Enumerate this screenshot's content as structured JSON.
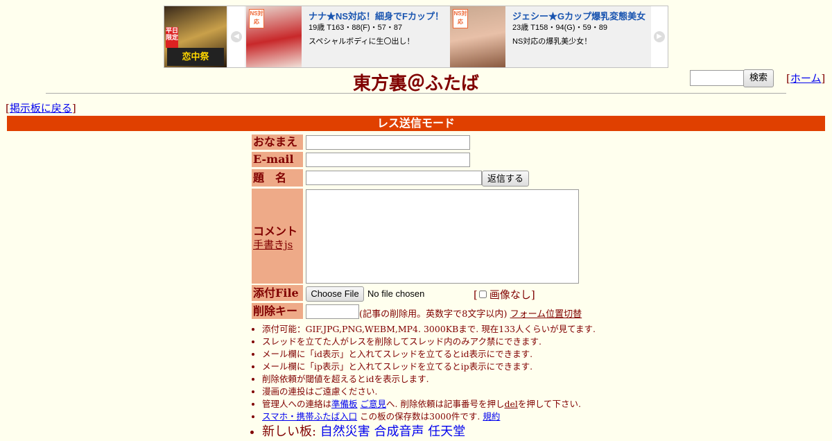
{
  "ad": {
    "left_banner": {
      "badge": "平日限定",
      "text": "恋中祭"
    },
    "cards": [
      {
        "title": "ナナ★NS対応！細身でFカップ！",
        "spec": "19歳 T163・88(F)・57・87",
        "desc": "スペシャルボディに生〇出し！",
        "badge": "NS対応"
      },
      {
        "title": "ジェシー★Gカップ爆乳変態美女",
        "spec": "23歳 T158・94(G)・59・89",
        "desc": "NS対応の爆乳美少女！",
        "badge": "NS対応"
      }
    ]
  },
  "header": {
    "title": "東方裏＠ふたば",
    "search_button": "検索",
    "home_link": "ホーム"
  },
  "nav": {
    "back_link": "掲示板に戻る"
  },
  "mode": {
    "label": "レス送信モード"
  },
  "form": {
    "name_label": "おなまえ",
    "email_label": "E-mail",
    "subject_label": "題　名",
    "submit_button": "返信する",
    "comment_label": "コメント",
    "handwrite_link": "手書きjs",
    "file_label": "添付File",
    "choose_file_button": "Choose File",
    "no_file_text": "No file chosen",
    "no_image_label": "画像なし",
    "delkey_label": "削除キー",
    "delkey_note": "(記事の削除用。英数字で8文字以内)",
    "form_toggle_link": "フォーム位置切替"
  },
  "notes": {
    "line1": "添付可能：GIF,JPG,PNG,WEBM,MP4. 3000KBまで. 現在133人くらいが見てます.",
    "line2": "スレッドを立てた人がレスを削除してスレッド内のみアク禁にできます.",
    "line3": "メール欄に「id表示」と入れてスレッドを立てるとid表示にできます.",
    "line4": "メール欄に「ip表示」と入れてスレッドを立てるとip表示にできます.",
    "line5": "削除依頼が閾値を超えるとidを表示します.",
    "line6": "漫画の連投はご遠慮ください.",
    "line7_pre": "管理人への連絡は",
    "line7_link1": "準備板",
    "line7_link2": "ご意見",
    "line7_mid": "へ. 削除依頼は記事番号を押し",
    "line7_link3": "del",
    "line7_post": "を押して下さい.",
    "line8_link1": "スマホ・携帯ふたば入口",
    "line8_mid": " この板の保存数は3000件です.",
    "line8_link2": "規約",
    "line9_pre": "新しい板: ",
    "line9_link1": "自然災害",
    "line9_link2": "合成音声",
    "line9_link3": "任天堂"
  },
  "colors": {
    "background": "#FFFFEE",
    "text": "#800000",
    "mode_bar": "#E04000",
    "label_bg": "#EEAA88",
    "link": "#0000EE"
  }
}
